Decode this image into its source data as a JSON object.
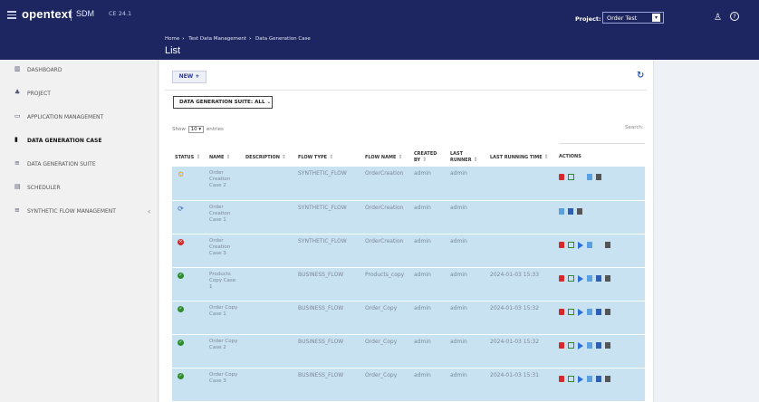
{
  "header": {
    "brand": "opentext",
    "app_name": "SDM",
    "version": "CE 24.1",
    "breadcrumb": [
      "Home",
      "Test Data Management",
      "Data Generation Case"
    ],
    "page_title": "List",
    "project_label": "Project:",
    "project_value": "Order Test"
  },
  "sidebar": {
    "items": [
      {
        "label": "DASHBOARD",
        "icon": "chart-icon"
      },
      {
        "label": "PROJECT",
        "icon": "users-icon"
      },
      {
        "label": "APPLICATION MANAGEMENT",
        "icon": "monitor-icon"
      },
      {
        "label": "DATA GENERATION CASE",
        "icon": "book-icon",
        "active": true
      },
      {
        "label": "DATA GENERATION SUITE",
        "icon": "list-icon"
      },
      {
        "label": "SCHEDULER",
        "icon": "calendar-icon"
      },
      {
        "label": "SYNTHETIC FLOW MANAGEMENT",
        "icon": "list-icon"
      }
    ],
    "collapse_glyph": "‹"
  },
  "main": {
    "new_button": "NEW +",
    "suite_filter": "DATA GENERATION SUITE: ALL",
    "show_label": "Show",
    "entries_value": "10",
    "entries_label": "entries",
    "search_label": "Search:",
    "columns": [
      "STATUS",
      "NAME",
      "DESCRIPTION",
      "FLOW TYPE",
      "FLOW NAME",
      "CREATED BY",
      "LAST RUNNER",
      "LAST RUNNING TIME",
      "ACTIONS"
    ],
    "rows": [
      {
        "status": "pending",
        "name": "Order Creation Case 2",
        "description": "",
        "flow_type": "SYNTHETIC_FLOW",
        "flow_name": "OrderCreation",
        "created_by": "admin",
        "last_runner": "admin",
        "last_running_time": "",
        "actions": [
          "delete",
          "edit",
          "gap",
          "schedule",
          "log"
        ]
      },
      {
        "status": "running",
        "name": "Order Creation Case 1",
        "description": "",
        "flow_type": "SYNTHETIC_FLOW",
        "flow_name": "OrderCreation",
        "created_by": "admin",
        "last_runner": "admin",
        "last_running_time": "",
        "actions": [
          "schedule",
          "doc",
          "log"
        ]
      },
      {
        "status": "failed",
        "name": "Order Creation Case 3",
        "description": "",
        "flow_type": "SYNTHETIC_FLOW",
        "flow_name": "OrderCreation",
        "created_by": "admin",
        "last_runner": "admin",
        "last_running_time": "",
        "actions": [
          "delete",
          "edit",
          "run",
          "schedule",
          "gap",
          "log"
        ]
      },
      {
        "status": "success",
        "name": "Products Copy Case 1",
        "description": "",
        "flow_type": "BUSINESS_FLOW",
        "flow_name": "Products_copy",
        "created_by": "admin",
        "last_runner": "admin",
        "last_running_time": "2024-01-03 15:33",
        "actions": [
          "delete",
          "edit",
          "run",
          "schedule",
          "doc",
          "log"
        ]
      },
      {
        "status": "success",
        "name": "Order Copy Case 1",
        "description": "",
        "flow_type": "BUSINESS_FLOW",
        "flow_name": "Order_Copy",
        "created_by": "admin",
        "last_runner": "admin",
        "last_running_time": "2024-01-03 15:32",
        "actions": [
          "delete",
          "edit",
          "run",
          "schedule",
          "doc",
          "log"
        ]
      },
      {
        "status": "success",
        "name": "Order Copy Case 2",
        "description": "",
        "flow_type": "BUSINESS_FLOW",
        "flow_name": "Order_Copy",
        "created_by": "admin",
        "last_runner": "admin",
        "last_running_time": "2024-01-03 15:32",
        "actions": [
          "delete",
          "edit",
          "run",
          "schedule",
          "doc",
          "log"
        ]
      },
      {
        "status": "success",
        "name": "Order Copy Case 3",
        "description": "",
        "flow_type": "BUSINESS_FLOW",
        "flow_name": "Order_Copy",
        "created_by": "admin",
        "last_runner": "admin",
        "last_running_time": "2024-01-03 15:31",
        "actions": [
          "delete",
          "edit",
          "run",
          "schedule",
          "doc",
          "log"
        ]
      }
    ]
  },
  "colors": {
    "header_bg": "#1d2660",
    "row_bg": "#c8e2f2",
    "success": "#2e8b2e",
    "failed": "#d62828",
    "pending": "#f0a020",
    "running": "#2d5fb3"
  }
}
